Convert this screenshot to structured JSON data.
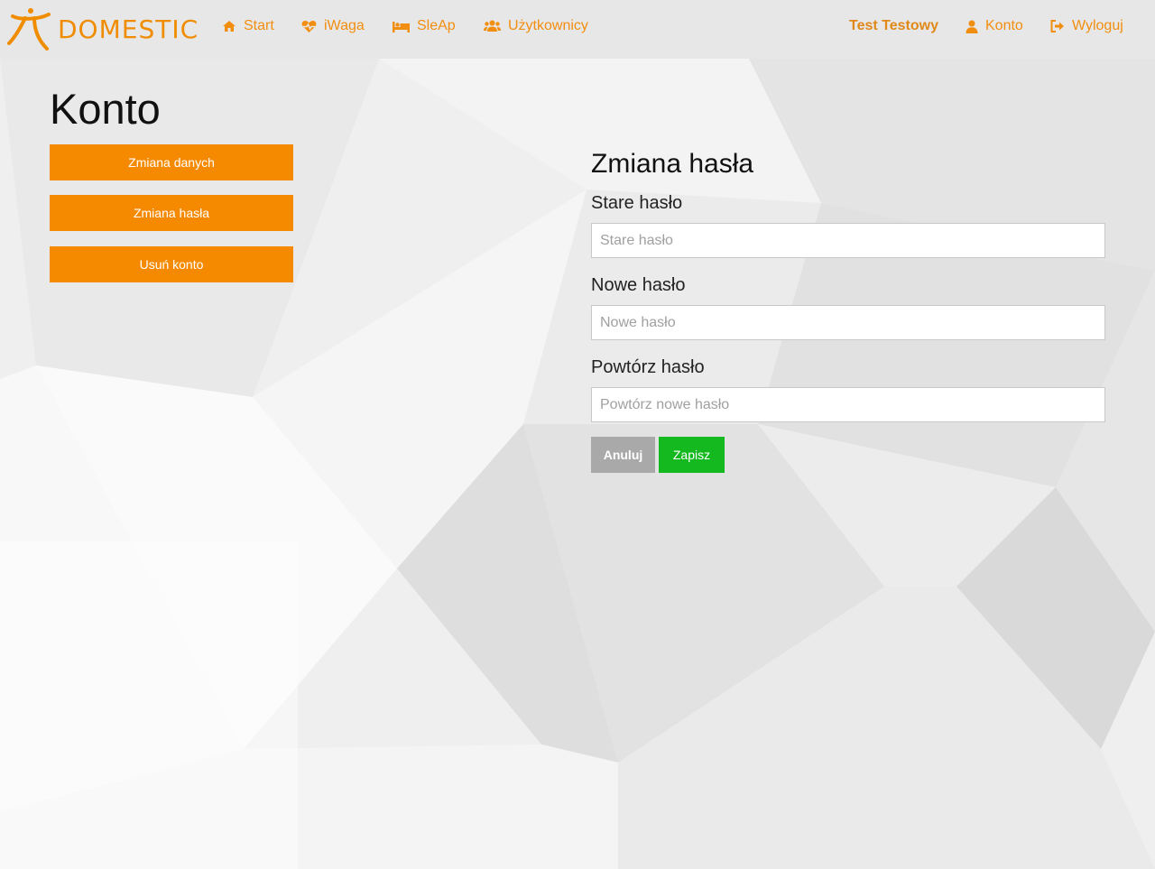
{
  "brand": {
    "name": "DOMESTIC",
    "logo": "domestic-figure-logo"
  },
  "nav": {
    "left": [
      {
        "label": "Start",
        "icon": "home-icon"
      },
      {
        "label": "iWaga",
        "icon": "heartbeat-icon"
      },
      {
        "label": "SleAp",
        "icon": "bed-icon"
      },
      {
        "label": "Użytkownicy",
        "icon": "users-icon"
      }
    ],
    "user_name": "Test Testowy",
    "account": {
      "label": "Konto",
      "icon": "user-icon"
    },
    "logout": {
      "label": "Wyloguj",
      "icon": "sign-out-icon"
    }
  },
  "page": {
    "title": "Konto"
  },
  "sidebar": {
    "buttons": [
      {
        "label": "Zmiana danych"
      },
      {
        "label": "Zmiana hasła"
      },
      {
        "label": "Usuń konto"
      }
    ]
  },
  "form": {
    "title": "Zmiana hasła",
    "old_password": {
      "label": "Stare hasło",
      "placeholder": "Stare hasło",
      "value": ""
    },
    "new_password": {
      "label": "Nowe hasło",
      "placeholder": "Nowe hasło",
      "value": ""
    },
    "repeat_password": {
      "label": "Powtórz hasło",
      "placeholder": "Powtórz nowe hasło",
      "value": ""
    },
    "cancel_label": "Anuluj",
    "save_label": "Zapisz"
  },
  "colors": {
    "accent": "#f58a00",
    "nav_link": "#f28e0f",
    "save": "#14b81f",
    "cancel": "#a9a9a9",
    "navbar_bg": "#e7e7e7"
  }
}
